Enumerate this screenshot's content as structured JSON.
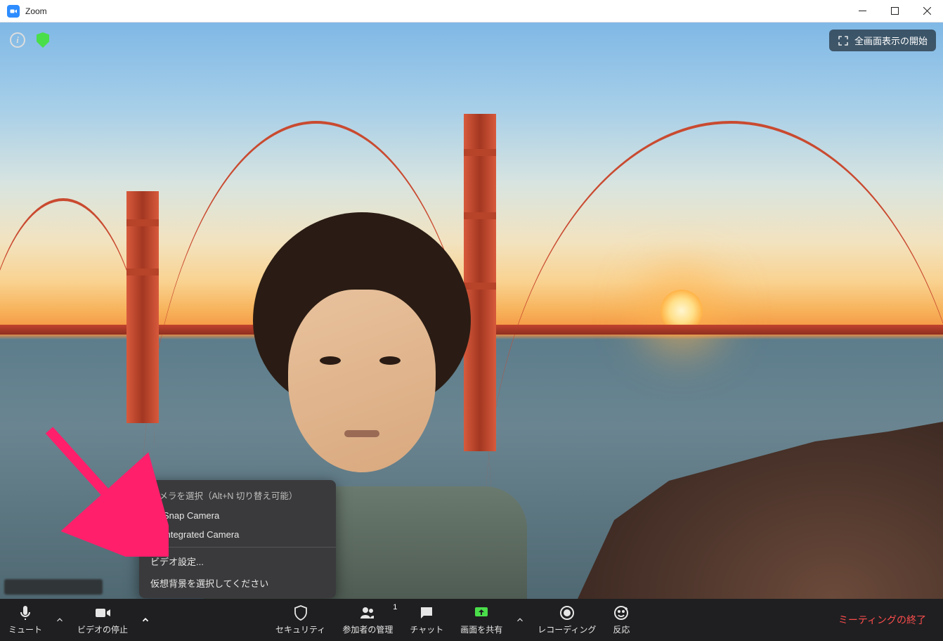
{
  "titlebar": {
    "title": "Zoom"
  },
  "top": {
    "fullscreen_label": "全画面表示の開始"
  },
  "video_menu": {
    "section_title": "カメラを選択（Alt+N 切り替え可能）",
    "items": [
      {
        "label": "Snap Camera",
        "checked": true
      },
      {
        "label": "Integrated Camera",
        "checked": false
      }
    ],
    "settings_items": [
      {
        "label": "ビデオ設定..."
      },
      {
        "label": "仮想背景を選択してください"
      }
    ]
  },
  "toolbar": {
    "mute": "ミュート",
    "stop_video": "ビデオの停止",
    "security": "セキュリティ",
    "participants": "参加者の管理",
    "participants_count": "1",
    "chat": "チャット",
    "share": "画面を共有",
    "record": "レコーディング",
    "reactions": "反応",
    "end": "ミーティングの終了"
  }
}
